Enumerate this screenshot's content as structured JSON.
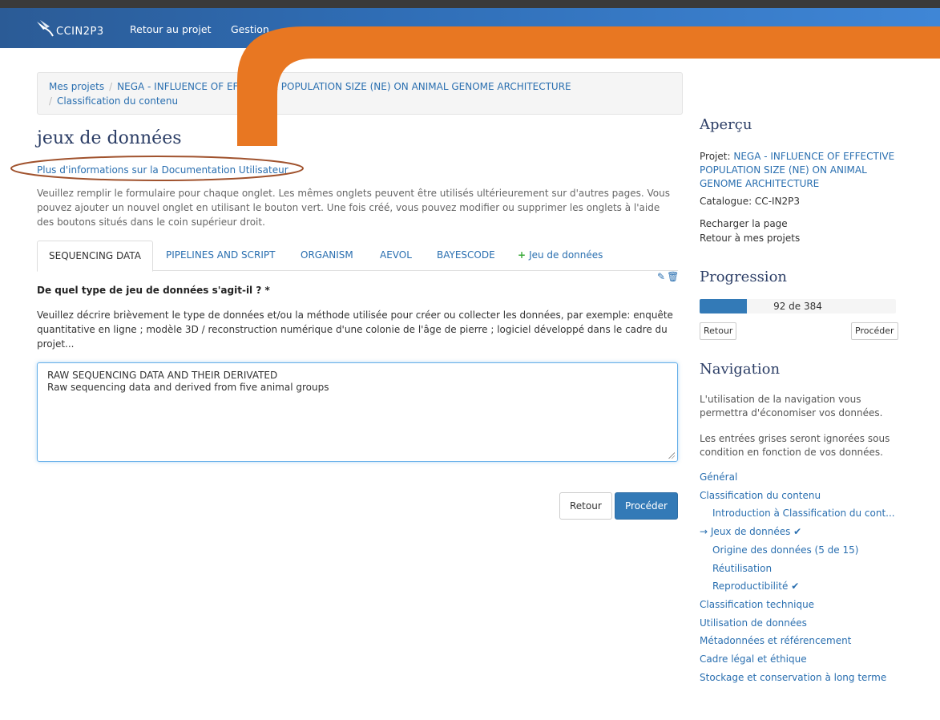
{
  "navbar": {
    "logo_text": "CCIN2P3",
    "links": [
      "Retour au projet",
      "Gestion"
    ]
  },
  "breadcrumb": {
    "items": [
      "Mes projets",
      "NEGA - INFLUENCE OF EFFECTIVE POPULATION SIZE (NE) ON ANIMAL GENOME ARCHITECTURE",
      "Classification du contenu"
    ]
  },
  "main": {
    "title": "jeux de données",
    "doc_link": "Plus d'informations sur la Documentation Utilisateur",
    "intro": "Veuillez remplir le formulaire pour chaque onglet. Les mêmes onglets peuvent être utilisés ultérieurement sur d'autres pages. Vous pouvez ajouter un nouvel onglet en utilisant le bouton vert. Une fois créé, vous pouvez modifier ou supprimer les onglets à l'aide des boutons situés dans le coin supérieur droit.",
    "tabs": [
      "SEQUENCING DATA",
      "PIPELINES AND SCRIPT",
      "ORGANISM",
      "AEVOL",
      "BAYESCODE"
    ],
    "add_tab_label": "Jeu de données",
    "question": "De quel type de jeu de données s'agit-il ? *",
    "help": "Veuillez décrire brièvement le type de données et/ou la méthode utilisée pour créer ou collecter les données, par exemple: enquête quantitative en ligne ; modèle 3D / reconstruction numérique d'une colonie de l'âge de pierre ; logiciel développé dans le cadre du projet...",
    "answer_line1": "RAW SEQUENCING DATA AND THEIR DERIVATED",
    "answer_line2": "Raw sequencing data and derived from five animal groups",
    "back_label": "Retour",
    "next_label": "Procéder"
  },
  "sidebar": {
    "overview_title": "Aperçu",
    "project_label": "Projet:",
    "project_name": "NEGA - INFLUENCE OF EFFECTIVE POPULATION SIZE (NE) ON ANIMAL GENOME ARCHITECTURE",
    "catalogue": "Catalogue: CC-IN2P3",
    "reload": "Recharger la page",
    "back_projects": "Retour à mes projets",
    "progress_title": "Progression",
    "progress_text": "92 de 384",
    "progress_fraction": 0.24,
    "progress_back": "Retour",
    "progress_next": "Procéder",
    "nav_title": "Navigation",
    "nav_help1": "L'utilisation de la navigation vous permettra d'économiser vos données.",
    "nav_help2": "Les entrées grises seront ignorées sous condition en fonction de vos données.",
    "nav_items": {
      "general": "Général",
      "classification": "Classification du contenu",
      "intro": "Introduction à Classification du cont...",
      "current_arrow": "→",
      "current": "Jeux de données",
      "origine": "Origine des données (5 de 15)",
      "reutilisation": "Réutilisation",
      "repro": "Reproductibilité",
      "technique": "Classification technique",
      "utilisation": "Utilisation de données",
      "metadonnees": "Métadonnées et référencement",
      "cadre": "Cadre légal et éthique",
      "stockage": "Stockage et conservation à long terme"
    }
  },
  "colors": {
    "navbar": "#2f6db5",
    "accent": "#337ab7",
    "callout_orange": "#e87722",
    "callout_ring": "#a0522d"
  }
}
